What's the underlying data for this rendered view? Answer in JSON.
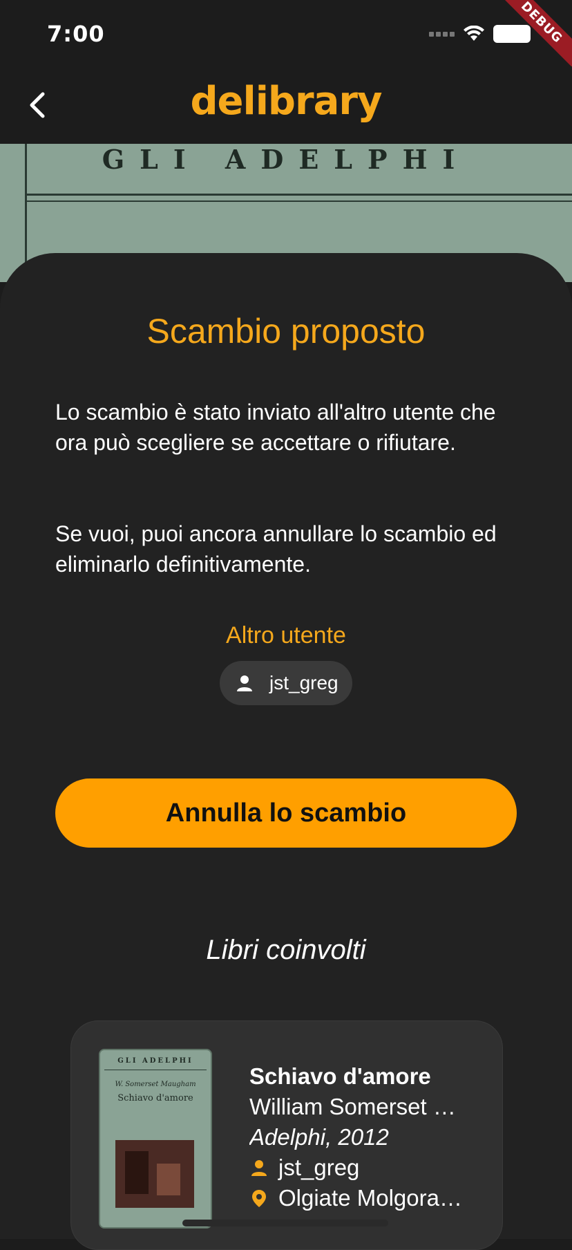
{
  "status_bar": {
    "time": "7:00",
    "debug_label": "DEBUG"
  },
  "app_bar": {
    "title": "delibrary"
  },
  "background_cover": {
    "series_text": "GLI ADELPHI"
  },
  "sheet": {
    "title": "Scambio proposto",
    "paragraph1": "Lo scambio è stato inviato all'altro utente che ora può scegliere se accettare o rifiutare.",
    "paragraph2": "Se vuoi, puoi ancora annullare lo scambio ed eliminarlo definitivamente.",
    "other_user_label": "Altro utente",
    "other_user_name": "jst_greg",
    "cancel_button": "Annulla lo scambio",
    "books_heading": "Libri coinvolti"
  },
  "book": {
    "cover_series": "GLI ADELPHI",
    "cover_author": "W. Somerset Maugham",
    "cover_title": "Schiavo d'amore",
    "title": "Schiavo d'amore",
    "author": "William Somerset …",
    "publisher": "Adelphi, 2012",
    "owner": "jst_greg",
    "location": "Olgiate Molgora…"
  },
  "colors": {
    "accent": "#f5a81c",
    "button": "#ff9f00",
    "background": "#222222"
  }
}
